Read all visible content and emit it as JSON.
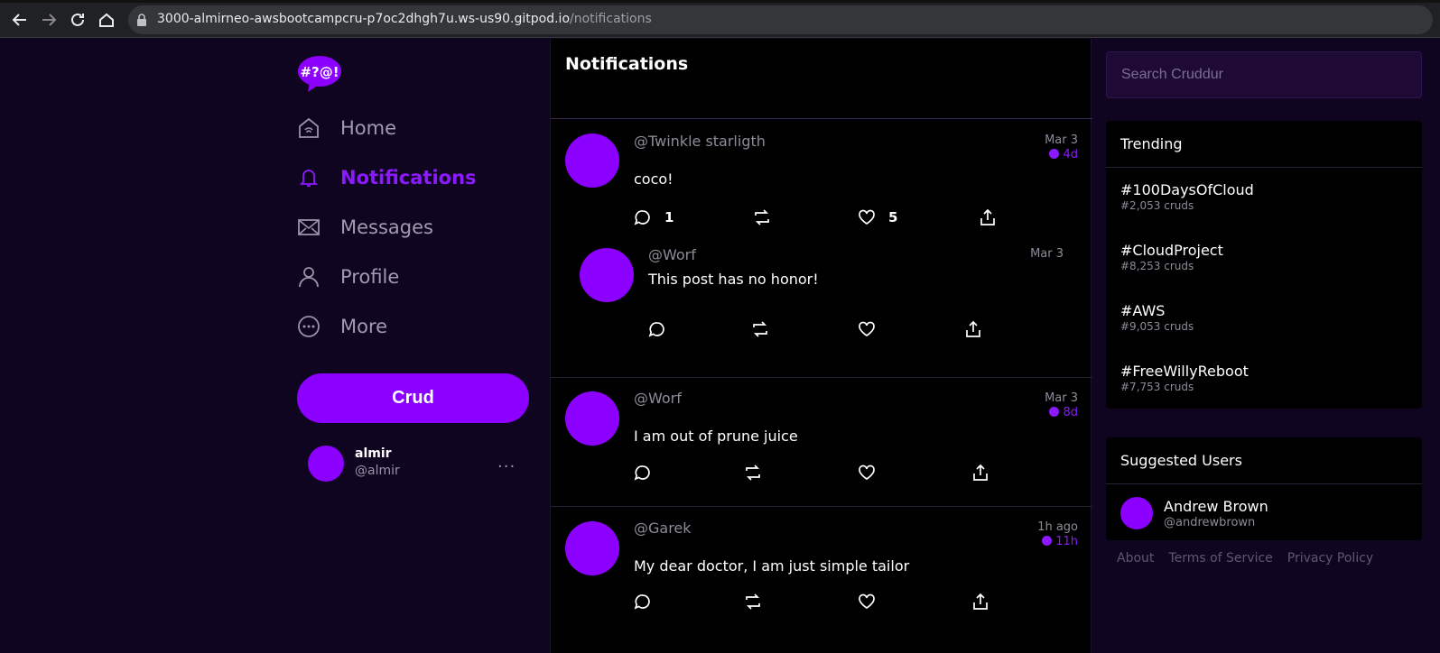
{
  "browser": {
    "url_host": "3000-almirneo-awsbootcampcru-p7oc2dhgh7u.ws-us90.gitpod.io",
    "url_path": "/notifications"
  },
  "sidebar": {
    "logo_text": "#?@!",
    "items": [
      {
        "label": "Home",
        "icon": "home-icon"
      },
      {
        "label": "Notifications",
        "icon": "bell-icon",
        "active": true
      },
      {
        "label": "Messages",
        "icon": "envelope-icon"
      },
      {
        "label": "Profile",
        "icon": "person-icon"
      },
      {
        "label": "More",
        "icon": "more-circle-icon"
      }
    ],
    "crud_label": "Crud",
    "user": {
      "name": "almir",
      "handle": "@almir",
      "more": "..."
    }
  },
  "main": {
    "title": "Notifications",
    "posts": [
      {
        "handle": "@Twinkle starligth",
        "message": "coco!",
        "date": "Mar 3",
        "expires": "4d",
        "replies": "1",
        "likes": "5"
      },
      {
        "handle": "@Worf",
        "message": "This post has no honor!",
        "date": "Mar 3"
      },
      {
        "handle": "@Worf",
        "message": "I am out of prune juice",
        "date": "Mar 3",
        "expires": "8d"
      },
      {
        "handle": "@Garek",
        "message": "My dear doctor, I am just simple tailor",
        "date": "1h ago",
        "expires": "11h"
      }
    ]
  },
  "right": {
    "search_placeholder": "Search Cruddur",
    "trending_title": "Trending",
    "trending": [
      {
        "name": "#100DaysOfCloud",
        "count": "#2,053 cruds"
      },
      {
        "name": "#CloudProject",
        "count": "#8,253 cruds"
      },
      {
        "name": "#AWS",
        "count": "#9,053 cruds"
      },
      {
        "name": "#FreeWillyReboot",
        "count": "#7,753 cruds"
      }
    ],
    "suggested_title": "Suggested Users",
    "suggested": [
      {
        "name": "Andrew Brown",
        "handle": "@andrewbrown"
      }
    ],
    "footer": [
      "About",
      "Terms of Service",
      "Privacy Policy"
    ]
  },
  "colors": {
    "accent": "#8c00ff",
    "background": "#0f0520",
    "panel": "#000000"
  }
}
